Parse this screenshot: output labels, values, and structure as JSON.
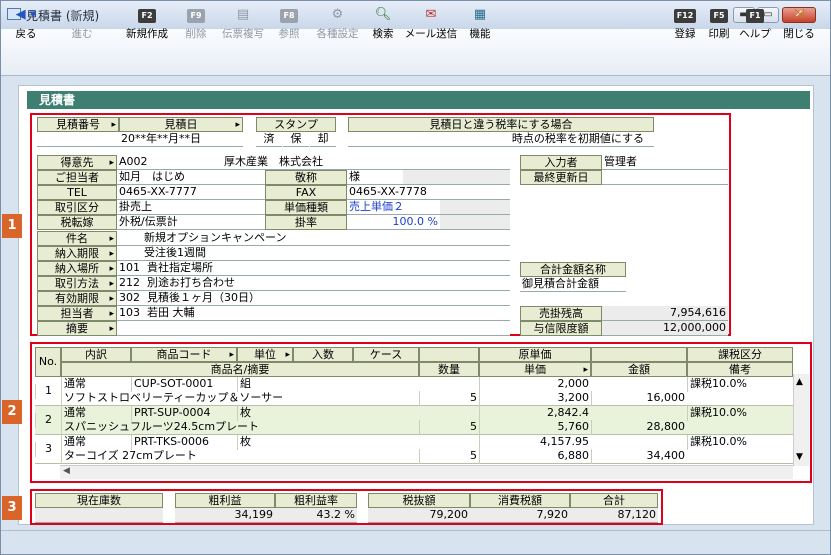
{
  "window": {
    "title": "見積書 (新規)",
    "min": "▬",
    "max": "▭",
    "close": "✕"
  },
  "toolbar": {
    "back": "戻る",
    "forward": "進む",
    "new": "新規作成",
    "delete": "削除",
    "copy": "伝票複写",
    "ref": "参照",
    "prices": "各種設定",
    "search": "検索",
    "mail": "メール送信",
    "func": "機能",
    "register": "登録",
    "print": "印刷",
    "help": "ヘルプ",
    "close": "閉じる",
    "k_new": "F2",
    "k_delete": "F9",
    "k_ref": "F8",
    "k_register": "F12",
    "k_print": "F5",
    "k_help": "F1"
  },
  "section_title": "見積書",
  "badges": [
    "1",
    "2",
    "3"
  ],
  "header": {
    "estimate_no_label": "見積番号",
    "estimate_date_label": "見積日",
    "estimate_date": "20**年**月**日",
    "stamp_label": "スタンプ",
    "stamp1": "済",
    "stamp2": "保",
    "stamp3": "却",
    "tax_label": "見積日と違う税率にする場合",
    "tax_value": "時点の税率を初期値にする"
  },
  "customer": {
    "client_label": "得意先",
    "client_code": "A002",
    "client_name": "厚木産業　株式会社",
    "contact_label": "ご担当者",
    "contact": "如月　はじめ",
    "title_label": "敬称",
    "title": "様",
    "tel_label": "TEL",
    "tel": "0465-XX-7777",
    "fax_label": "FAX",
    "fax": "0465-XX-7778",
    "trade_label": "取引区分",
    "trade": "掛売上",
    "price_type_label": "単価種類",
    "price_type": "売上単価２",
    "tax_mode_label": "税転嫁",
    "tax_mode": "外税/伝票計",
    "rate_label": "掛率",
    "rate": "100.0 %",
    "subject_label": "件名",
    "subject": "新規オプションキャンペーン",
    "delivery_label": "納入期限",
    "delivery": "受注後1週間",
    "place_label": "納入場所",
    "place_code": "101",
    "place": "貴社指定場所",
    "method_label": "取引方法",
    "method_code": "212",
    "method": "別途お打ち合わせ",
    "valid_label": "有効期限",
    "valid_code": "302",
    "valid": "見積後１ヶ月（30日）",
    "staff_label": "担当者",
    "staff_code": "103",
    "staff": "若田 大輔",
    "memo_label": "摘要"
  },
  "side": {
    "entry_label": "入力者",
    "entry": "管理者",
    "updated_label": "最終更新日",
    "total_name_label": "合計金額名称",
    "total_name": "御見積合計金額",
    "receivable_label": "売掛残高",
    "receivable": "7,954,616",
    "credit_label": "与信限度額",
    "credit": "12,000,000"
  },
  "grid": {
    "headers": {
      "no": "No.",
      "kind": "内訳",
      "code": "商品コード",
      "unit": "単位",
      "qty_in": "入数",
      "case": "ケース",
      "cost": "原単価",
      "tax_kind": "課税区分",
      "name": "商品名/摘要",
      "qty": "数量",
      "price": "単価",
      "amount": "金額",
      "note": "備考"
    },
    "rows": [
      {
        "no": "1",
        "kind": "通常",
        "code": "CUP-SOT-0001",
        "unit": "組",
        "name": "ソフトストロベリーティーカップ＆ソーサー",
        "qty": "5",
        "cost": "2,000",
        "price": "3,200",
        "amount": "16,000",
        "tax": "課税10.0%"
      },
      {
        "no": "2",
        "kind": "通常",
        "code": "PRT-SUP-0004",
        "unit": "枚",
        "name": "スパニッシュフルーツ24.5cmプレート",
        "qty": "5",
        "cost": "2,842.4",
        "price": "5,760",
        "amount": "28,800",
        "tax": "課税10.0%"
      },
      {
        "no": "3",
        "kind": "通常",
        "code": "PRT-TKS-0006",
        "unit": "枚",
        "name": "ターコイズ 27cmプレート",
        "qty": "5",
        "cost": "4,157.95",
        "price": "6,880",
        "amount": "34,400",
        "tax": "課税10.0%"
      }
    ]
  },
  "totals": {
    "stock_label": "現在庫数",
    "stock": "",
    "profit_label": "粗利益",
    "profit": "34,199",
    "margin_label": "粗利益率",
    "margin": "43.2 %",
    "pretax_label": "税抜額",
    "pretax": "79,200",
    "tax_label": "消費税額",
    "tax": "7,920",
    "total_label": "合計",
    "total": "87,120"
  }
}
